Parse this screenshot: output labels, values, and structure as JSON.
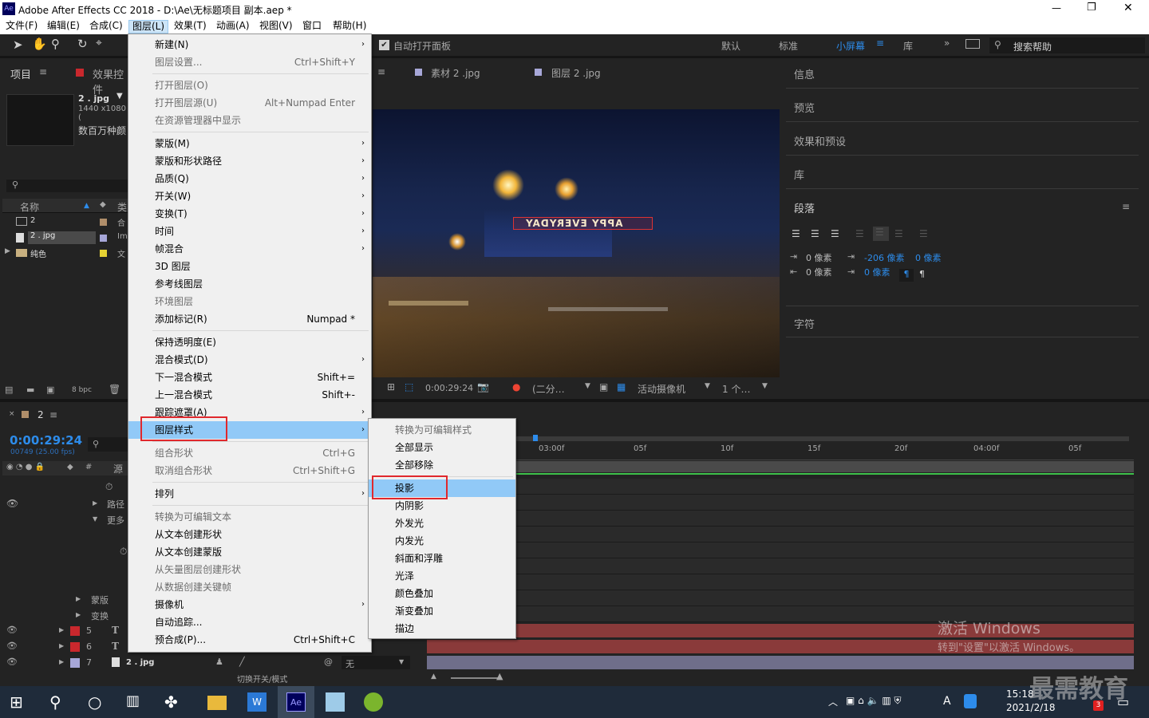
{
  "window": {
    "title": "Adobe After Effects CC 2018 - D:\\Ae\\无标题项目 副本.aep *",
    "app_icon": "Ae"
  },
  "window_controls": {
    "min": "—",
    "max": "❐",
    "close": "✕"
  },
  "menubar": [
    "文件(F)",
    "编辑(E)",
    "合成(C)",
    "图层(L)",
    "效果(T)",
    "动画(A)",
    "视图(V)",
    "窗口",
    "帮助(H)"
  ],
  "toolbar": {
    "auto_open": "自动打开面板",
    "workspaces": [
      "默认",
      "标准",
      "小屏幕",
      "库"
    ],
    "search_help": "搜索帮助"
  },
  "project_panel": {
    "tab_project": "项目",
    "tab_effects": "效果控件",
    "item_name": "2 . jpg",
    "item_dims": "1440 x1080 (",
    "item_desc": "数百万种颜",
    "col_name": "名称",
    "col_type": "类",
    "rows": [
      {
        "name": "2",
        "type": "合"
      },
      {
        "name": "2 . jpg",
        "type": "Im"
      },
      {
        "name": "纯色",
        "type": "文"
      }
    ],
    "bpc": "8 bpc"
  },
  "viewer": {
    "tab1": "素材 2 .jpg",
    "tab2": "图层 2 .jpg",
    "overlay_text": "APPY EVERYDAY",
    "timecode": "0:00:29:24",
    "resolution": "(二分…",
    "camera": "活动摄像机",
    "views": "1 个…"
  },
  "right_panel": {
    "items": [
      "信息",
      "预览",
      "效果和预设",
      "库",
      "段落",
      "字符"
    ],
    "para_values": [
      "0 像素",
      "0 像素",
      "-206 像素",
      "0 像素",
      "0 像素"
    ]
  },
  "timeline": {
    "comp_tab": "2",
    "timecode": "0:00:29:24",
    "frames": "00749 (25.00 fps)",
    "col_hash": "#",
    "col_source": "源",
    "ruler": [
      "03:00f",
      "05f",
      "10f",
      "15f",
      "20f",
      "04:00f",
      "05f"
    ],
    "layer_props": [
      "路径",
      "更多",
      "蒙版",
      "变换"
    ],
    "layers": [
      {
        "num": "5",
        "type": "T"
      },
      {
        "num": "6",
        "type": "T"
      },
      {
        "num": "7",
        "name": "2 . jpg",
        "mode": "无"
      }
    ],
    "footer": "切换开关/模式"
  },
  "layer_menu": {
    "items": [
      {
        "label": "新建(N)",
        "sc": "",
        "sub": true,
        "dis": false
      },
      {
        "label": "图层设置...",
        "sc": "Ctrl+Shift+Y",
        "sub": false,
        "dis": true
      },
      {
        "label": "打开图层(O)",
        "sc": "",
        "sub": false,
        "dis": true
      },
      {
        "label": "打开图层源(U)",
        "sc": "Alt+Numpad Enter",
        "sub": false,
        "dis": true
      },
      {
        "label": "在资源管理器中显示",
        "sc": "",
        "sub": false,
        "dis": true
      },
      {
        "label": "蒙版(M)",
        "sc": "",
        "sub": true,
        "dis": false
      },
      {
        "label": "蒙版和形状路径",
        "sc": "",
        "sub": true,
        "dis": false
      },
      {
        "label": "品质(Q)",
        "sc": "",
        "sub": true,
        "dis": false
      },
      {
        "label": "开关(W)",
        "sc": "",
        "sub": true,
        "dis": false
      },
      {
        "label": "变换(T)",
        "sc": "",
        "sub": true,
        "dis": false
      },
      {
        "label": "时间",
        "sc": "",
        "sub": true,
        "dis": false
      },
      {
        "label": "帧混合",
        "sc": "",
        "sub": true,
        "dis": false
      },
      {
        "label": "3D 图层",
        "sc": "",
        "sub": false,
        "dis": false
      },
      {
        "label": "参考线图层",
        "sc": "",
        "sub": false,
        "dis": false
      },
      {
        "label": "环境图层",
        "sc": "",
        "sub": false,
        "dis": true
      },
      {
        "label": "添加标记(R)",
        "sc": "Numpad *",
        "sub": false,
        "dis": false
      },
      {
        "label": "保持透明度(E)",
        "sc": "",
        "sub": false,
        "dis": false
      },
      {
        "label": "混合模式(D)",
        "sc": "",
        "sub": true,
        "dis": false
      },
      {
        "label": "下一混合模式",
        "sc": "Shift+=",
        "sub": false,
        "dis": false
      },
      {
        "label": "上一混合模式",
        "sc": "Shift+-",
        "sub": false,
        "dis": false
      },
      {
        "label": "跟踪遮罩(A)",
        "sc": "",
        "sub": true,
        "dis": false
      },
      {
        "label": "图层样式",
        "sc": "",
        "sub": true,
        "dis": false
      },
      {
        "label": "组合形状",
        "sc": "Ctrl+G",
        "sub": false,
        "dis": true
      },
      {
        "label": "取消组合形状",
        "sc": "Ctrl+Shift+G",
        "sub": false,
        "dis": true
      },
      {
        "label": "排列",
        "sc": "",
        "sub": true,
        "dis": false
      },
      {
        "label": "转换为可编辑文本",
        "sc": "",
        "sub": false,
        "dis": true
      },
      {
        "label": "从文本创建形状",
        "sc": "",
        "sub": false,
        "dis": false
      },
      {
        "label": "从文本创建蒙版",
        "sc": "",
        "sub": false,
        "dis": false
      },
      {
        "label": "从矢量图层创建形状",
        "sc": "",
        "sub": false,
        "dis": true
      },
      {
        "label": "从数据创建关键帧",
        "sc": "",
        "sub": false,
        "dis": true
      },
      {
        "label": "摄像机",
        "sc": "",
        "sub": true,
        "dis": false
      },
      {
        "label": "自动追踪...",
        "sc": "",
        "sub": false,
        "dis": false
      },
      {
        "label": "预合成(P)...",
        "sc": "Ctrl+Shift+C",
        "sub": false,
        "dis": false
      }
    ]
  },
  "style_submenu": {
    "items": [
      {
        "label": "转换为可编辑样式",
        "dis": true
      },
      {
        "label": "全部显示",
        "dis": false
      },
      {
        "label": "全部移除",
        "dis": false
      },
      {
        "label": "投影",
        "dis": false
      },
      {
        "label": "内阴影",
        "dis": false
      },
      {
        "label": "外发光",
        "dis": false
      },
      {
        "label": "内发光",
        "dis": false
      },
      {
        "label": "斜面和浮雕",
        "dis": false
      },
      {
        "label": "光泽",
        "dis": false
      },
      {
        "label": "颜色叠加",
        "dis": false
      },
      {
        "label": "渐变叠加",
        "dis": false
      },
      {
        "label": "描边",
        "dis": false
      }
    ]
  },
  "watermark": {
    "line1": "激活 Windows",
    "line2": "转到\"设置\"以激活 Windows。",
    "brand": "最需教育"
  },
  "taskbar": {
    "time": "15:18",
    "date": "2021/2/18",
    "ime": "A",
    "badge": "3"
  }
}
